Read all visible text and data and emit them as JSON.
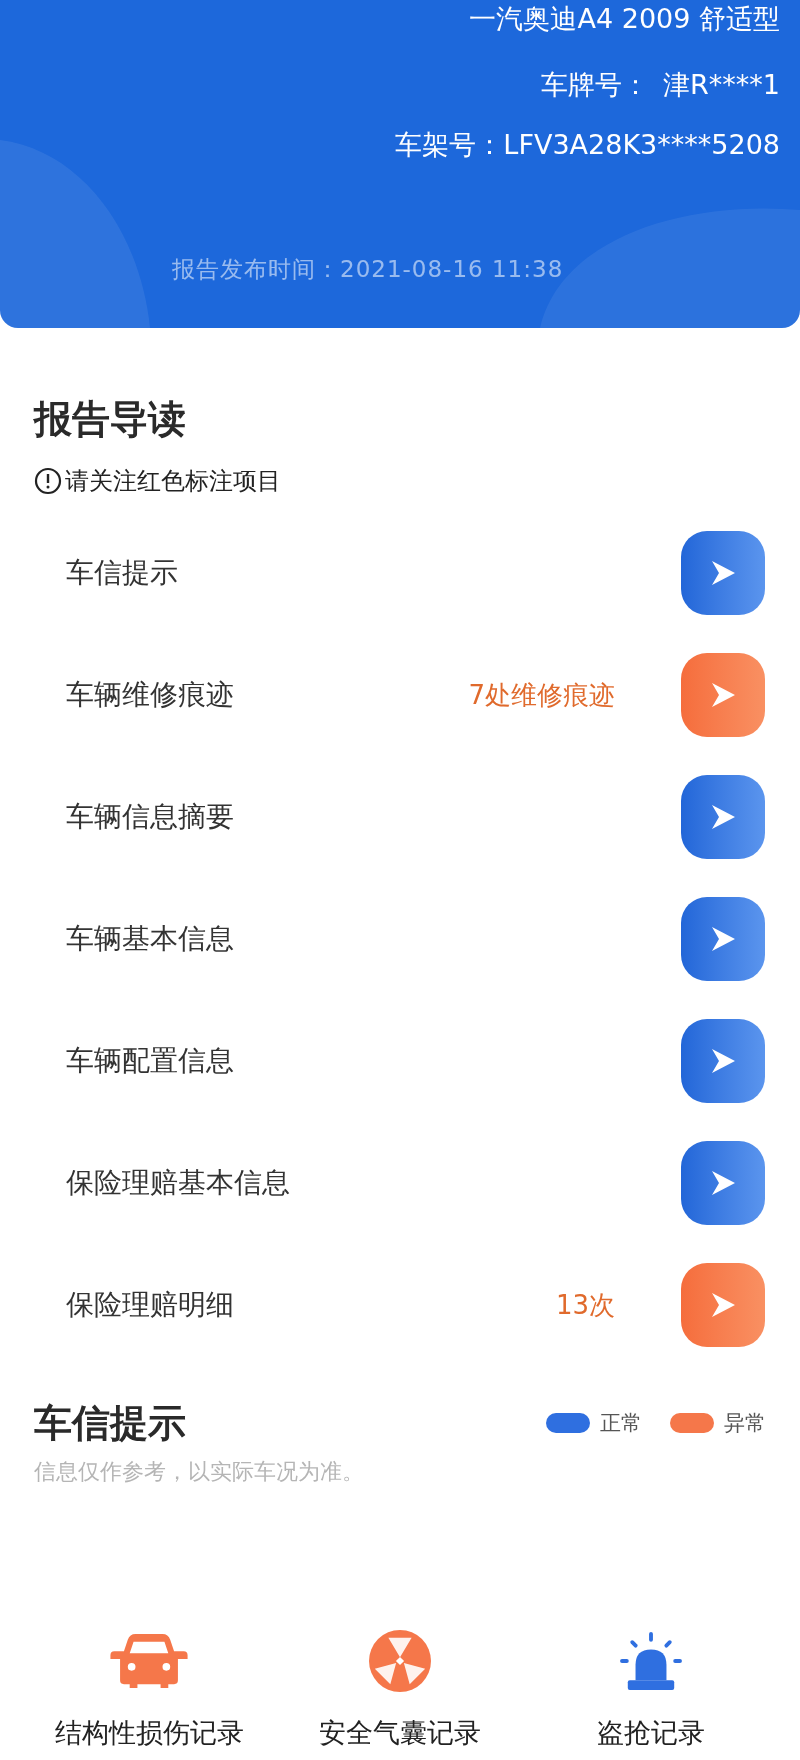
{
  "header": {
    "model": "一汽奥迪A4 2009 舒适型",
    "plate_label": "车牌号：",
    "plate": "津R****1",
    "vin_label": "车架号：",
    "vin": "LFV3A28K3****5208",
    "published": "报告发布时间：2021-08-16 11:38"
  },
  "guide": {
    "title": "报告导读",
    "note": "请关注红色标注项目",
    "items": [
      {
        "label": "车信提示",
        "abnormal": false
      },
      {
        "label": "车辆维修痕迹",
        "detail": "7处维修痕迹",
        "abnormal": true
      },
      {
        "label": "车辆信息摘要",
        "abnormal": false
      },
      {
        "label": "车辆基本信息",
        "abnormal": false
      },
      {
        "label": "车辆配置信息",
        "abnormal": false
      },
      {
        "label": "保险理赔基本信息",
        "abnormal": false
      },
      {
        "label": "保险理赔明细",
        "detail": "13次",
        "abnormal": true
      }
    ]
  },
  "tips": {
    "title": "车信提示",
    "subtitle": "信息仅作参考，以实际车况为准。",
    "legend": [
      {
        "label": "正常",
        "color": "#2f6fe0"
      },
      {
        "label": "异常",
        "color": "#f5774a"
      }
    ],
    "records": [
      {
        "kind": "car",
        "label": "结构性损伤记录",
        "abnormal": true
      },
      {
        "kind": "airbag",
        "label": "安全气囊记录",
        "abnormal": true
      },
      {
        "kind": "alarm",
        "label": "盗抢记录",
        "abnormal": false
      }
    ]
  }
}
